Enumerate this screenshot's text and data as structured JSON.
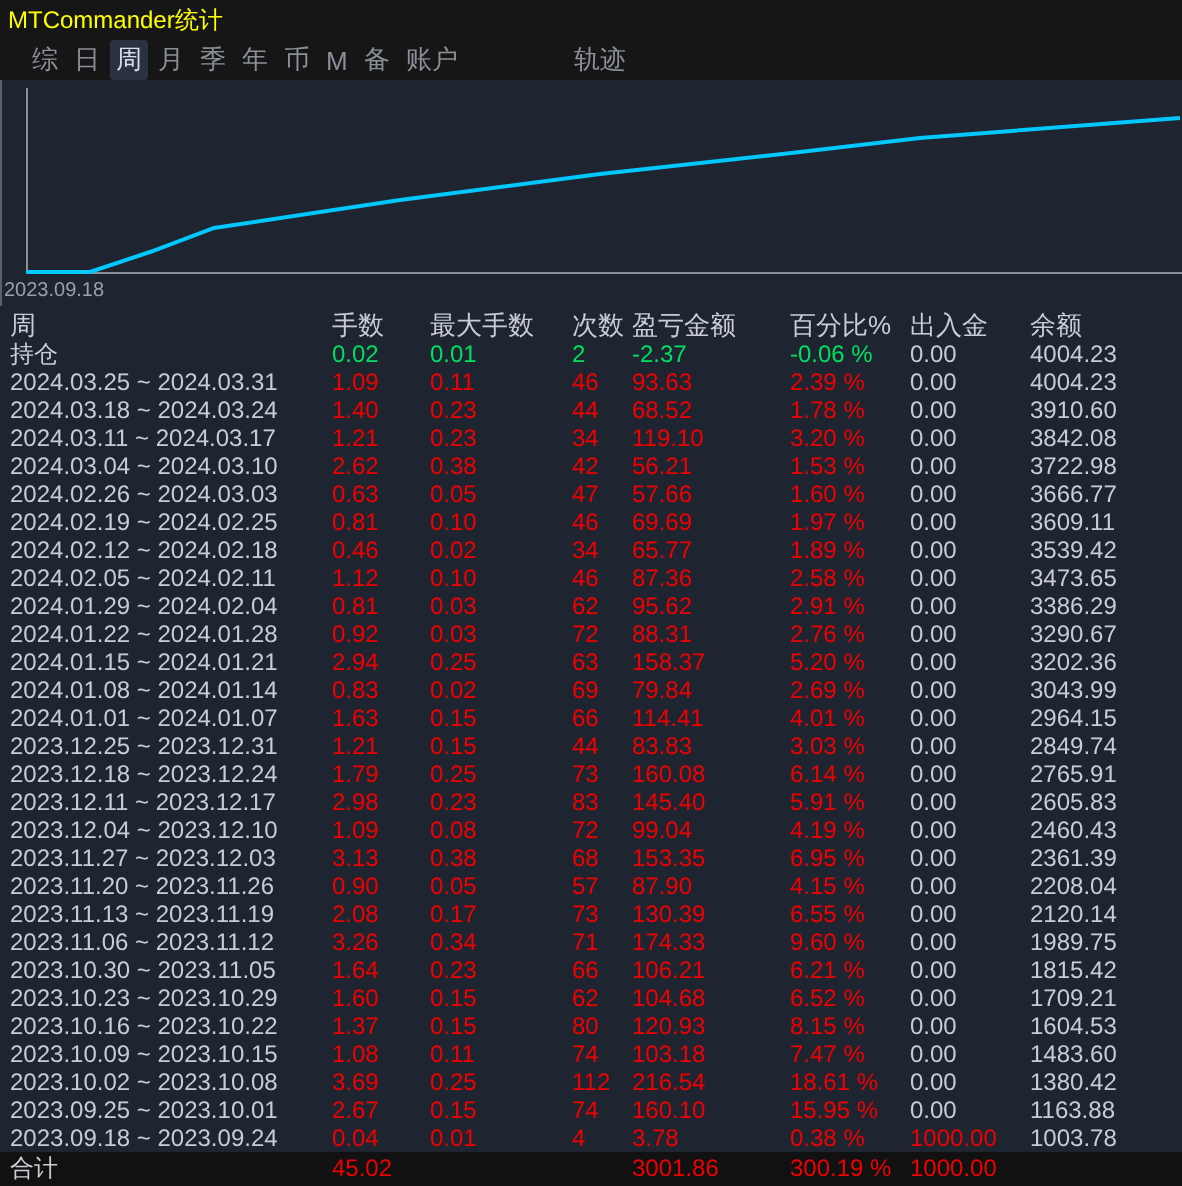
{
  "window": {
    "title": "MTCommander统计"
  },
  "tabs": [
    {
      "label": "综",
      "selected": false,
      "kind": "view"
    },
    {
      "label": "日",
      "selected": false,
      "kind": "view"
    },
    {
      "label": "周",
      "selected": true,
      "kind": "view"
    },
    {
      "label": "月",
      "selected": false,
      "kind": "view"
    },
    {
      "label": "季",
      "selected": false,
      "kind": "view"
    },
    {
      "label": "年",
      "selected": false,
      "kind": "view"
    },
    {
      "label": "币",
      "selected": false,
      "kind": "view"
    },
    {
      "label": "M",
      "selected": false,
      "kind": "view"
    },
    {
      "label": "备",
      "selected": false,
      "kind": "view"
    },
    {
      "label": "账户",
      "selected": false,
      "kind": "view"
    },
    {
      "label": "轨迹",
      "selected": false,
      "kind": "tool"
    }
  ],
  "chart": {
    "start_label": "2023.09.18"
  },
  "table": {
    "columns": [
      "周",
      "手数",
      "最大手数",
      "次数",
      "盈亏金额",
      "百分比%",
      "出入金",
      "余额"
    ],
    "rows": [
      {
        "kind": "open",
        "deposit_marked": false,
        "cells": [
          "持仓",
          "0.02",
          "0.01",
          "2",
          "-2.37",
          "-0.06 %",
          "0.00",
          "4004.23"
        ]
      },
      {
        "kind": "period",
        "deposit_marked": false,
        "cells": [
          "2024.03.25 ~ 2024.03.31",
          "1.09",
          "0.11",
          "46",
          "93.63",
          "2.39 %",
          "0.00",
          "4004.23"
        ]
      },
      {
        "kind": "period",
        "deposit_marked": false,
        "cells": [
          "2024.03.18 ~ 2024.03.24",
          "1.40",
          "0.23",
          "44",
          "68.52",
          "1.78 %",
          "0.00",
          "3910.60"
        ]
      },
      {
        "kind": "period",
        "deposit_marked": false,
        "cells": [
          "2024.03.11 ~ 2024.03.17",
          "1.21",
          "0.23",
          "34",
          "119.10",
          "3.20 %",
          "0.00",
          "3842.08"
        ]
      },
      {
        "kind": "period",
        "deposit_marked": false,
        "cells": [
          "2024.03.04 ~ 2024.03.10",
          "2.62",
          "0.38",
          "42",
          "56.21",
          "1.53 %",
          "0.00",
          "3722.98"
        ]
      },
      {
        "kind": "period",
        "deposit_marked": false,
        "cells": [
          "2024.02.26 ~ 2024.03.03",
          "0.63",
          "0.05",
          "47",
          "57.66",
          "1.60 %",
          "0.00",
          "3666.77"
        ]
      },
      {
        "kind": "period",
        "deposit_marked": false,
        "cells": [
          "2024.02.19 ~ 2024.02.25",
          "0.81",
          "0.10",
          "46",
          "69.69",
          "1.97 %",
          "0.00",
          "3609.11"
        ]
      },
      {
        "kind": "period",
        "deposit_marked": false,
        "cells": [
          "2024.02.12 ~ 2024.02.18",
          "0.46",
          "0.02",
          "34",
          "65.77",
          "1.89 %",
          "0.00",
          "3539.42"
        ]
      },
      {
        "kind": "period",
        "deposit_marked": false,
        "cells": [
          "2024.02.05 ~ 2024.02.11",
          "1.12",
          "0.10",
          "46",
          "87.36",
          "2.58 %",
          "0.00",
          "3473.65"
        ]
      },
      {
        "kind": "period",
        "deposit_marked": false,
        "cells": [
          "2024.01.29 ~ 2024.02.04",
          "0.81",
          "0.03",
          "62",
          "95.62",
          "2.91 %",
          "0.00",
          "3386.29"
        ]
      },
      {
        "kind": "period",
        "deposit_marked": false,
        "cells": [
          "2024.01.22 ~ 2024.01.28",
          "0.92",
          "0.03",
          "72",
          "88.31",
          "2.76 %",
          "0.00",
          "3290.67"
        ]
      },
      {
        "kind": "period",
        "deposit_marked": false,
        "cells": [
          "2024.01.15 ~ 2024.01.21",
          "2.94",
          "0.25",
          "63",
          "158.37",
          "5.20 %",
          "0.00",
          "3202.36"
        ]
      },
      {
        "kind": "period",
        "deposit_marked": false,
        "cells": [
          "2024.01.08 ~ 2024.01.14",
          "0.83",
          "0.02",
          "69",
          "79.84",
          "2.69 %",
          "0.00",
          "3043.99"
        ]
      },
      {
        "kind": "period",
        "deposit_marked": false,
        "cells": [
          "2024.01.01 ~ 2024.01.07",
          "1.63",
          "0.15",
          "66",
          "114.41",
          "4.01 %",
          "0.00",
          "2964.15"
        ]
      },
      {
        "kind": "period",
        "deposit_marked": false,
        "cells": [
          "2023.12.25 ~ 2023.12.31",
          "1.21",
          "0.15",
          "44",
          "83.83",
          "3.03 %",
          "0.00",
          "2849.74"
        ]
      },
      {
        "kind": "period",
        "deposit_marked": false,
        "cells": [
          "2023.12.18 ~ 2023.12.24",
          "1.79",
          "0.25",
          "73",
          "160.08",
          "6.14 %",
          "0.00",
          "2765.91"
        ]
      },
      {
        "kind": "period",
        "deposit_marked": false,
        "cells": [
          "2023.12.11 ~ 2023.12.17",
          "2.98",
          "0.23",
          "83",
          "145.40",
          "5.91 %",
          "0.00",
          "2605.83"
        ]
      },
      {
        "kind": "period",
        "deposit_marked": false,
        "cells": [
          "2023.12.04 ~ 2023.12.10",
          "1.09",
          "0.08",
          "72",
          "99.04",
          "4.19 %",
          "0.00",
          "2460.43"
        ]
      },
      {
        "kind": "period",
        "deposit_marked": false,
        "cells": [
          "2023.11.27 ~ 2023.12.03",
          "3.13",
          "0.38",
          "68",
          "153.35",
          "6.95 %",
          "0.00",
          "2361.39"
        ]
      },
      {
        "kind": "period",
        "deposit_marked": false,
        "cells": [
          "2023.11.20 ~ 2023.11.26",
          "0.90",
          "0.05",
          "57",
          "87.90",
          "4.15 %",
          "0.00",
          "2208.04"
        ]
      },
      {
        "kind": "period",
        "deposit_marked": false,
        "cells": [
          "2023.11.13 ~ 2023.11.19",
          "2.08",
          "0.17",
          "73",
          "130.39",
          "6.55 %",
          "0.00",
          "2120.14"
        ]
      },
      {
        "kind": "period",
        "deposit_marked": false,
        "cells": [
          "2023.11.06 ~ 2023.11.12",
          "3.26",
          "0.34",
          "71",
          "174.33",
          "9.60 %",
          "0.00",
          "1989.75"
        ]
      },
      {
        "kind": "period",
        "deposit_marked": false,
        "cells": [
          "2023.10.30 ~ 2023.11.05",
          "1.64",
          "0.23",
          "66",
          "106.21",
          "6.21 %",
          "0.00",
          "1815.42"
        ]
      },
      {
        "kind": "period",
        "deposit_marked": false,
        "cells": [
          "2023.10.23 ~ 2023.10.29",
          "1.60",
          "0.15",
          "62",
          "104.68",
          "6.52 %",
          "0.00",
          "1709.21"
        ]
      },
      {
        "kind": "period",
        "deposit_marked": false,
        "cells": [
          "2023.10.16 ~ 2023.10.22",
          "1.37",
          "0.15",
          "80",
          "120.93",
          "8.15 %",
          "0.00",
          "1604.53"
        ]
      },
      {
        "kind": "period",
        "deposit_marked": false,
        "cells": [
          "2023.10.09 ~ 2023.10.15",
          "1.08",
          "0.11",
          "74",
          "103.18",
          "7.47 %",
          "0.00",
          "1483.60"
        ]
      },
      {
        "kind": "period",
        "deposit_marked": false,
        "cells": [
          "2023.10.02 ~ 2023.10.08",
          "3.69",
          "0.25",
          "112",
          "216.54",
          "18.61 %",
          "0.00",
          "1380.42"
        ]
      },
      {
        "kind": "period",
        "deposit_marked": false,
        "cells": [
          "2023.09.25 ~ 2023.10.01",
          "2.67",
          "0.15",
          "74",
          "160.10",
          "15.95 %",
          "0.00",
          "1163.88"
        ]
      },
      {
        "kind": "period",
        "deposit_marked": true,
        "cells": [
          "2023.09.18 ~ 2023.09.24",
          "0.04",
          "0.01",
          "4",
          "3.78",
          "0.38 %",
          "1000.00",
          "1003.78"
        ]
      },
      {
        "kind": "total",
        "deposit_marked": true,
        "cells": [
          "合计",
          "45.02",
          null,
          null,
          "3001.86",
          "300.19 %",
          "1000.00",
          null
        ]
      }
    ]
  }
}
